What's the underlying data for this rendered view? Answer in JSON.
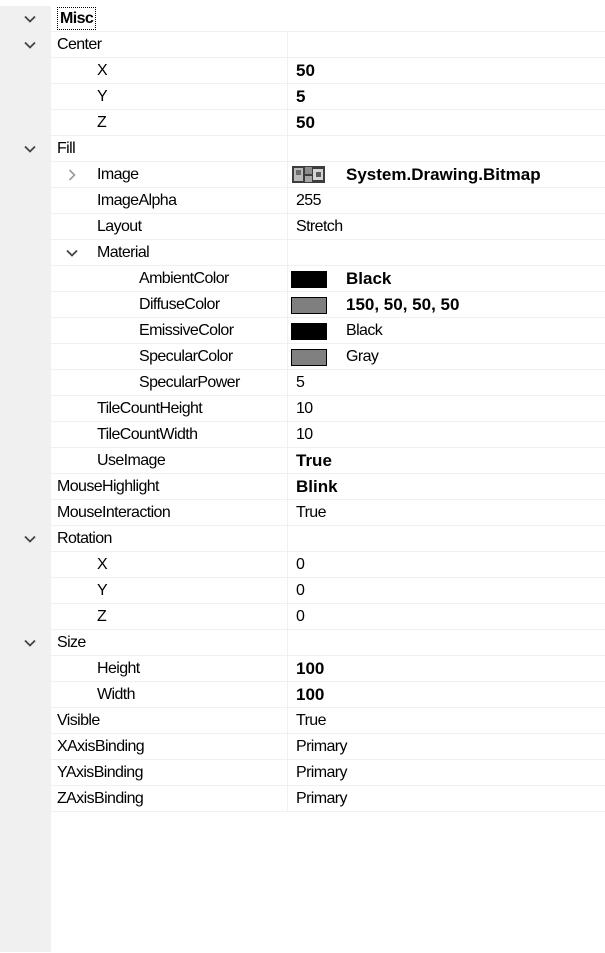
{
  "property_grid": {
    "categories": {
      "misc": "Misc"
    },
    "rows": {
      "center": {
        "name": "Center",
        "value": ""
      },
      "center_x": {
        "name": "X",
        "value": "50"
      },
      "center_y": {
        "name": "Y",
        "value": "5"
      },
      "center_z": {
        "name": "Z",
        "value": "50"
      },
      "fill": {
        "name": "Fill",
        "value": ""
      },
      "image": {
        "name": "Image",
        "value": "System.Drawing.Bitmap"
      },
      "image_alpha": {
        "name": "ImageAlpha",
        "value": "255"
      },
      "layout": {
        "name": "Layout",
        "value": "Stretch"
      },
      "material": {
        "name": "Material",
        "value": ""
      },
      "ambient_color": {
        "name": "AmbientColor",
        "value": "Black",
        "swatch_color": "#000000"
      },
      "diffuse_color": {
        "name": "DiffuseColor",
        "value": "150, 50, 50, 50",
        "swatch_color": "#7f7f7f"
      },
      "emissive_color": {
        "name": "EmissiveColor",
        "value": "Black",
        "swatch_color": "#000000"
      },
      "specular_color": {
        "name": "SpecularColor",
        "value": "Gray",
        "swatch_color": "#808080"
      },
      "specular_power": {
        "name": "SpecularPower",
        "value": "5"
      },
      "tile_count_height": {
        "name": "TileCountHeight",
        "value": "10"
      },
      "tile_count_width": {
        "name": "TileCountWidth",
        "value": "10"
      },
      "use_image": {
        "name": "UseImage",
        "value": "True"
      },
      "mouse_highlight": {
        "name": "MouseHighlight",
        "value": "Blink"
      },
      "mouse_interaction": {
        "name": "MouseInteraction",
        "value": "True"
      },
      "rotation": {
        "name": "Rotation",
        "value": ""
      },
      "rotation_x": {
        "name": "X",
        "value": "0"
      },
      "rotation_y": {
        "name": "Y",
        "value": "0"
      },
      "rotation_z": {
        "name": "Z",
        "value": "0"
      },
      "size": {
        "name": "Size",
        "value": ""
      },
      "size_height": {
        "name": "Height",
        "value": "100"
      },
      "size_width": {
        "name": "Width",
        "value": "100"
      },
      "visible": {
        "name": "Visible",
        "value": "True"
      },
      "x_axis_binding": {
        "name": "XAxisBinding",
        "value": "Primary"
      },
      "y_axis_binding": {
        "name": "YAxisBinding",
        "value": "Primary"
      },
      "z_axis_binding": {
        "name": "ZAxisBinding",
        "value": "Primary"
      }
    },
    "colors": {
      "margin": "#f0f0f0",
      "gridline": "#f0f0f0",
      "glyph": "#444444"
    },
    "icons": {
      "expanded": "chevron-down-icon",
      "collapsed": "chevron-right-icon",
      "bitmap_preview": "bitmap-thumbnail-icon"
    }
  }
}
